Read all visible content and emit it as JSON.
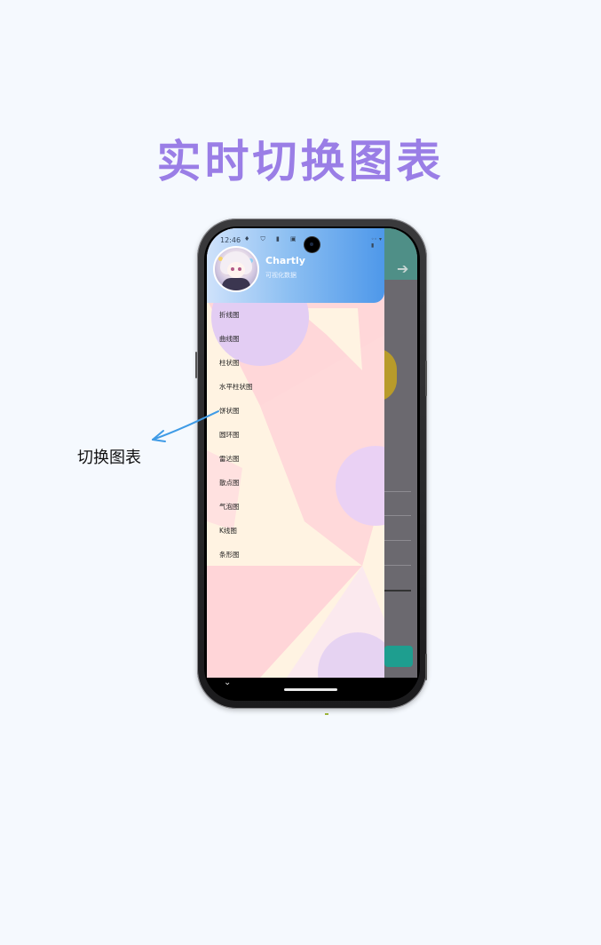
{
  "headline": "实时切换图表",
  "callout": "切换图表",
  "phone": {
    "status_time": "12:46",
    "status_icons": "♦ ⛉ ▮ ▣",
    "status_right": "◦◦ ▾ ▮",
    "drawer": {
      "app_name": "Chartly",
      "app_subtitle": "可视化数据",
      "menu_items": [
        "折线图",
        "曲线图",
        "柱状图",
        "水平柱状图",
        "饼状图",
        "圆环图",
        "雷达图",
        "散点图",
        "气泡图",
        "K线图",
        "条形图"
      ]
    },
    "app_bar_arrow": "➔",
    "nav_chevron": "⌄"
  },
  "colors": {
    "headline": "#9a7ee6",
    "drawer_header_start": "#cfe2fb",
    "drawer_header_end": "#4e98ea",
    "drawer_bg": "#ffd7d9",
    "arrow": "#3f9be6"
  }
}
